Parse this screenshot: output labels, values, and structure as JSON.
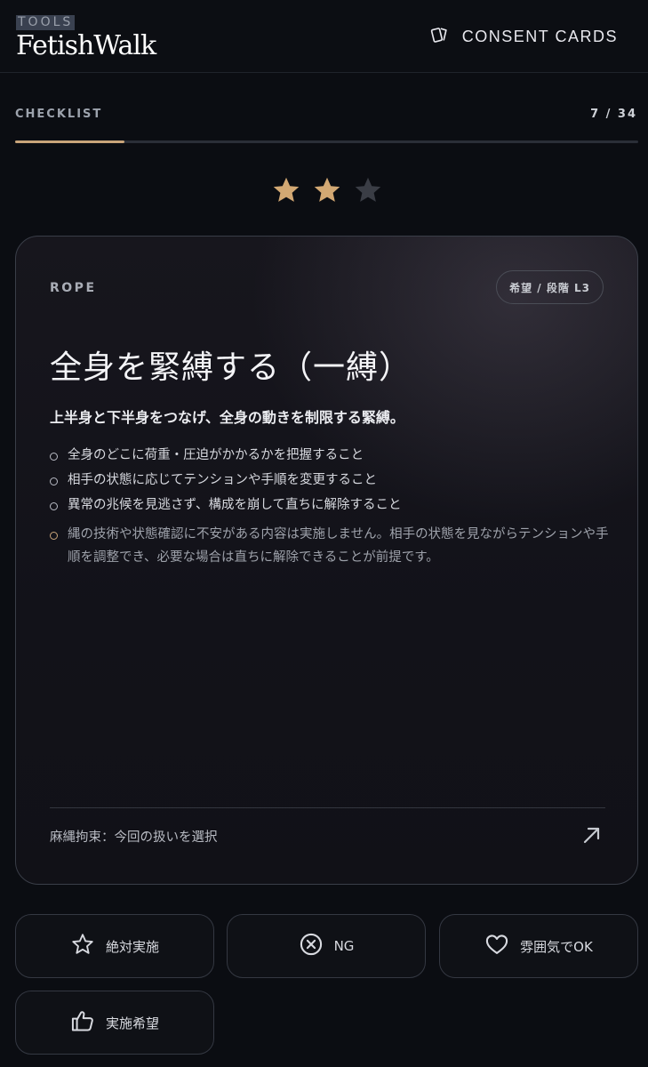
{
  "header": {
    "brand_sub": "TOOLS",
    "brand_title": "FetishWalk",
    "consent_label": "CONSENT CARDS"
  },
  "checklist": {
    "label": "CHECKLIST",
    "counter": "7 / 34",
    "progress_fraction": 0.176
  },
  "rating": {
    "filled": 2,
    "total": 3,
    "filled_color": "#d2a873",
    "empty_color": "#3a3d45"
  },
  "card": {
    "category": "ROPE",
    "badge": "希望 / 段階 L3",
    "title": "全身を緊縛する（一縛）",
    "description": "上半身と下半身をつなげ、全身の動きを制限する緊縛。",
    "bullets": [
      "全身のどこに荷重・圧迫がかかるかを把握すること",
      "相手の状態に応じてテンションや手順を変更すること",
      "異常の兆候を見逃さず、構成を崩して直ちに解除すること"
    ],
    "note": "縄の技術や状態確認に不安がある内容は実施しません。相手の状態を見ながらテンションや手順を調整でき、必要な場合は直ちに解除できることが前提です。",
    "footer": "麻縄拘束：今回の扱いを選択",
    "footer_icon": "arrow-up-right-icon"
  },
  "actions": [
    {
      "label": "絶対実施",
      "icon": "star-outline-icon"
    },
    {
      "label": "NG",
      "icon": "circle-x-icon"
    },
    {
      "label": "雰囲気でOK",
      "icon": "heart-outline-icon"
    },
    {
      "label": "実施希望",
      "icon": "thumbs-up-icon"
    }
  ],
  "colors": {
    "accent": "#c9a57a",
    "background": "#0b0d12"
  }
}
